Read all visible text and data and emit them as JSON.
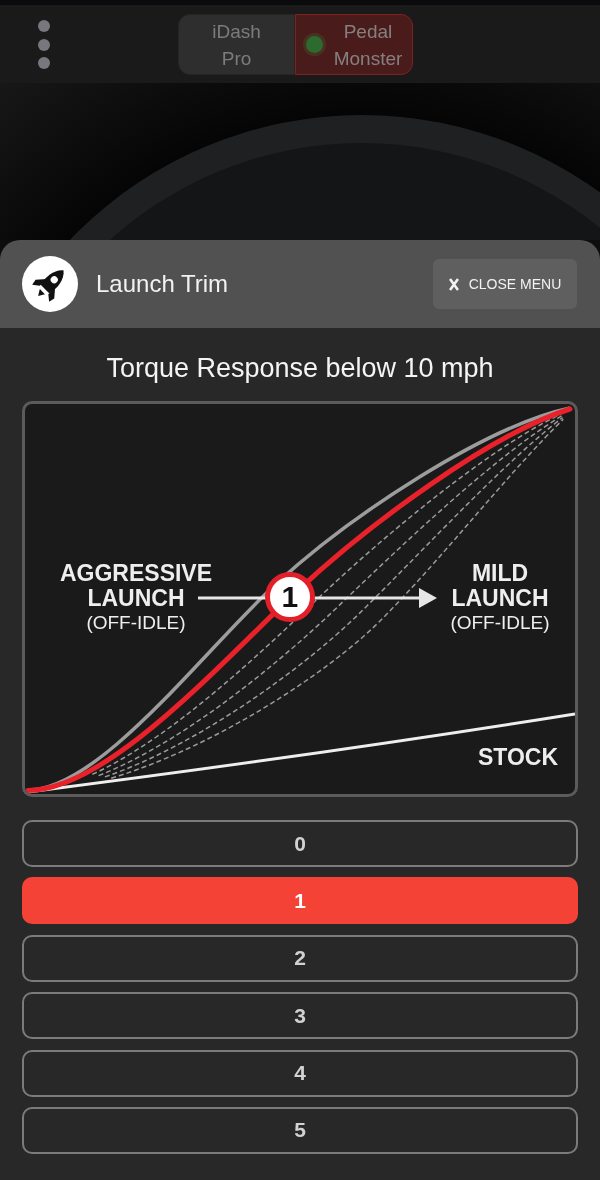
{
  "segment_control": {
    "segments": [
      {
        "label": "iDash Pro",
        "selected": false,
        "connected": false
      },
      {
        "label": "Pedal Monster",
        "selected": true,
        "connected": true
      }
    ]
  },
  "sheet": {
    "title": "Launch Trim",
    "close_button": "CLOSE MENU"
  },
  "chart_title": "Torque Response below 10 mph",
  "illustration": {
    "left_label": {
      "title": "AGGRESSIVE LAUNCH",
      "note": "(OFF-IDLE)"
    },
    "right_label": {
      "title": "MILD LAUNCH",
      "note": "(OFF-IDLE)"
    },
    "marker": "1",
    "baseline_label": "STOCK"
  },
  "options": [
    {
      "label": "0",
      "selected": false
    },
    {
      "label": "1",
      "selected": true
    },
    {
      "label": "2",
      "selected": false
    },
    {
      "label": "3",
      "selected": false
    },
    {
      "label": "4",
      "selected": false
    },
    {
      "label": "5",
      "selected": false
    }
  ]
}
